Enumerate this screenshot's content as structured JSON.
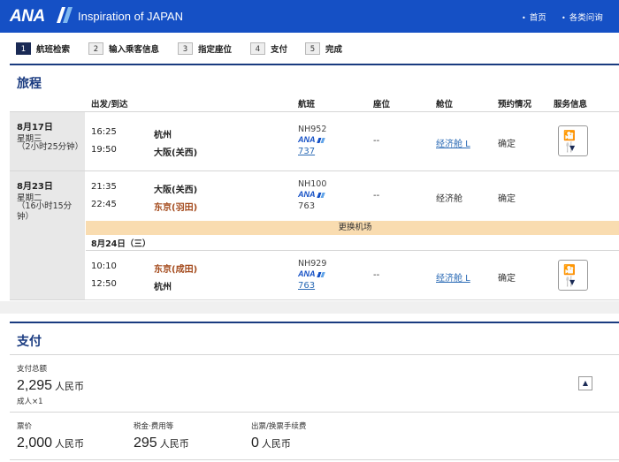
{
  "header": {
    "logo_text": "ANA",
    "tagline": "Inspiration of JAPAN",
    "links": [
      {
        "label": "首页"
      },
      {
        "label": "各类问询"
      }
    ],
    "brand_color": "#1550c5"
  },
  "steps": [
    {
      "num": "1",
      "label": "航班检索",
      "active": true
    },
    {
      "num": "2",
      "label": "输入乘客信息",
      "active": false
    },
    {
      "num": "3",
      "label": "指定座位",
      "active": false
    },
    {
      "num": "4",
      "label": "支付",
      "active": false
    },
    {
      "num": "5",
      "label": "完成",
      "active": false
    }
  ],
  "itinerary": {
    "title": "旅程",
    "columns": {
      "depart_arrive": "出发/到达",
      "flight": "航班",
      "seat": "座位",
      "class": "舱位",
      "booking": "预约情况",
      "service": "服务信息"
    },
    "segments": [
      {
        "date": "8月17日",
        "weekday": "星期三",
        "duration": "（2小时25分钟）",
        "dep_time": "16:25",
        "dep_city": "杭州",
        "arr_time": "19:50",
        "arr_city": "大阪(关西)",
        "flight_no": "NH952",
        "airline": "ANA",
        "aircraft": "737",
        "seat": "--",
        "cabin": "经济舱 L",
        "status": "确定",
        "service_icon": "meal-icon"
      },
      {
        "date": "8月23日",
        "weekday": "星期二",
        "duration": "（16小时15分钟）",
        "dep_time": "21:35",
        "dep_city": "大阪(关西)",
        "arr_time": "22:45",
        "arr_city": "东京(羽田)",
        "flight_no": "NH100",
        "airline": "ANA",
        "aircraft": "763",
        "seat": "--",
        "cabin": "经济舱",
        "status": "确定"
      },
      {
        "transfer_note": "更换机场",
        "sub_date": "8月24日（三）",
        "dep_time": "10:10",
        "dep_city": "东京(成田)",
        "arr_time": "12:50",
        "arr_city": "杭州",
        "flight_no": "NH929",
        "airline": "ANA",
        "aircraft": "763",
        "seat": "--",
        "cabin": "经济舱 L",
        "status": "确定",
        "service_icon": "meal-icon"
      }
    ]
  },
  "payment": {
    "title": "支付",
    "total_label": "支付总额",
    "total_amount": "2,295",
    "currency": "人民币",
    "passengers": "成人×1",
    "fare_label": "票价",
    "fare_amount": "2,000",
    "tax_label": "税金·费用等",
    "tax_amount": "295",
    "fee_label": "出票/换票手续费",
    "fee_amount": "0"
  }
}
